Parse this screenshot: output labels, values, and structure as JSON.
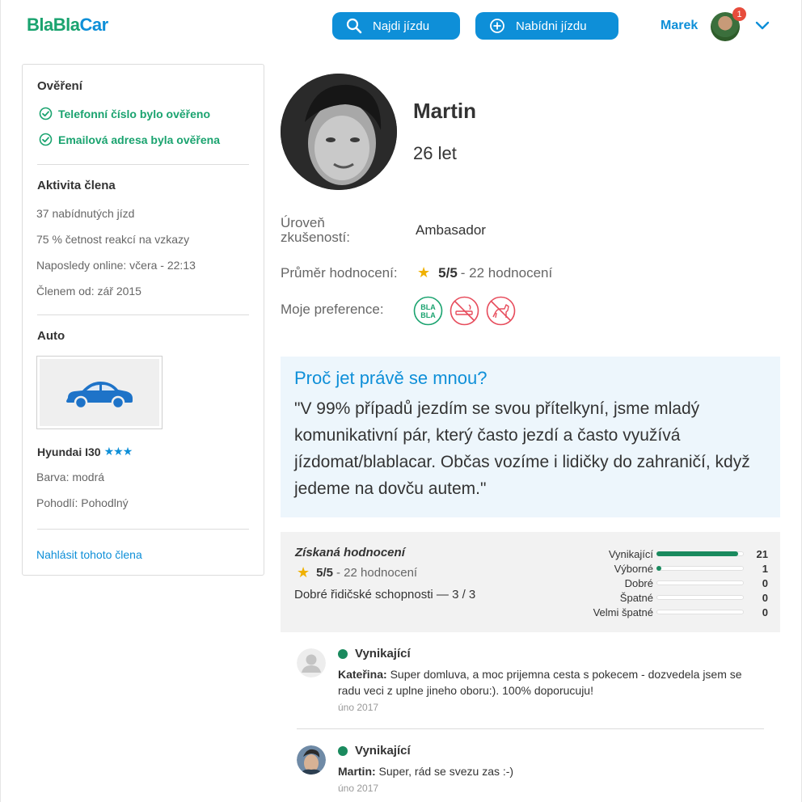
{
  "header": {
    "logo_bla1": "Bla",
    "logo_bla2": "Bla",
    "logo_car": "Car",
    "find_label": "Najdi jízdu",
    "offer_label": "Nabídni jízdu",
    "user_name": "Marek",
    "notifications": "1"
  },
  "sidebar": {
    "verification_title": "Ověření",
    "phone_verified": "Telefonní číslo bylo ověřeno",
    "email_verified": "Emailová adresa byla ověřena",
    "activity_title": "Aktivita člena",
    "rides_offered": "37 nabídnutých jízd",
    "response_rate": "75 % četnost reakcí na vzkazy",
    "last_online": "Naposledy online: včera - 22:13",
    "member_since": "Členem od: zář 2015",
    "car_title": "Auto",
    "car_name": "Hyundai I30",
    "car_stars": "★★★",
    "car_color": "Barva: modrá",
    "car_comfort": "Pohodlí: Pohodlný",
    "report_link": "Nahlásit tohoto člena"
  },
  "profile": {
    "name": "Martin",
    "age": "26 let",
    "experience_label": "Úroveň zkušeností:",
    "experience_value": "Ambasador",
    "rating_label": "Průměr hodnocení:",
    "rating_value": "5/5",
    "rating_count": "- 22 hodnocení",
    "pref_label": "Moje preference:",
    "preferences": [
      "bla-bla-chatty-icon",
      "no-smoking-icon",
      "no-pets-icon"
    ]
  },
  "about": {
    "title": "Proč jet právě se mnou?",
    "text": "\"V 99% případů jezdím se svou přítelkyní, jsme mladý komunikativní pár, který často jezdí a často využívá jízdomat/blablacar. Občas vozíme i lidičky do zahraničí, když jedeme na dovču autem.\""
  },
  "ratings": {
    "title": "Získaná hodnocení",
    "avg": "5/5",
    "count": "- 22 hodnocení",
    "driving_skill": "Dobré řidičské schopnosti — 3 / 3",
    "breakdown": [
      {
        "label": "Vynikající",
        "count": "21",
        "fraction": 0.95
      },
      {
        "label": "Výborné",
        "count": "1",
        "fraction": 0.05
      },
      {
        "label": "Dobré",
        "count": "0",
        "fraction": 0
      },
      {
        "label": "Špatné",
        "count": "0",
        "fraction": 0
      },
      {
        "label": "Velmi špatné",
        "count": "0",
        "fraction": 0
      }
    ]
  },
  "reviews": [
    {
      "rating": "Vynikající",
      "author": "Kateřina:",
      "text": " Super domluva, a moc prijemna cesta s pokecem - dozvedela jsem se radu veci z uplne jineho oboru:). 100% doporucuju!",
      "date": "úno 2017"
    },
    {
      "rating": "Vynikající",
      "author": "Martin:",
      "text": " Super, rád se svezu zas :-)",
      "date": "úno 2017"
    }
  ],
  "colors": {
    "brand_blue": "#0e8fd8",
    "brand_green": "#1aa36f",
    "rating_green": "#1a8a5e",
    "star_yellow": "#f0b100",
    "pref_red": "#e74c5c"
  }
}
